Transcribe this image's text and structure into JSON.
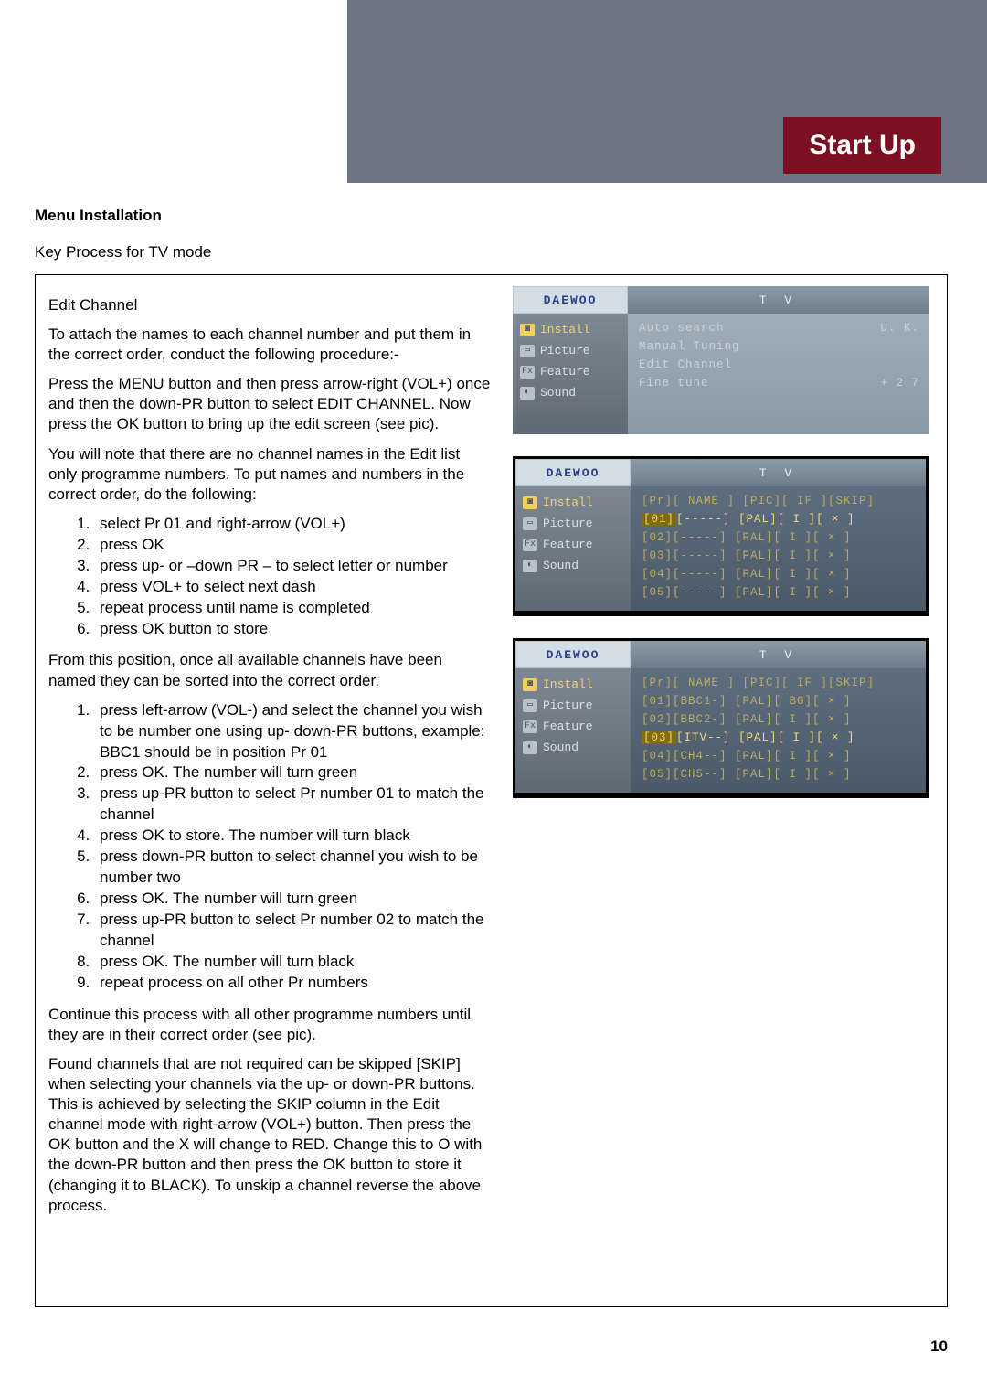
{
  "banner": {
    "title": "Start Up"
  },
  "heading": "Menu Installation",
  "subheading": "Key Process for TV mode",
  "edit_heading": "Edit Channel",
  "p1": "To attach the names to each channel number and put them in the correct order, conduct the following procedure:-",
  "p2": "Press the MENU button and then press arrow-right (VOL+) once and then the down-PR button to select EDIT CHANNEL. Now press the OK button to bring up the edit screen (see pic).",
  "p3": "You will note that there are no channel names in the Edit list only programme numbers. To put names and numbers in the correct order, do the following:",
  "listA": [
    "select Pr 01 and right-arrow (VOL+)",
    "press OK",
    "press up- or –down PR – to select letter or number",
    "press VOL+ to select next dash",
    "repeat process until name is completed",
    "press OK button to store"
  ],
  "p4": "From this position, once all available channels have been named they can be sorted into the correct order.",
  "listB": [
    "press left-arrow (VOL-) and select the channel you wish to be number one using up- down-PR buttons, example: BBC1 should be in position Pr 01",
    "press OK. The number will turn green",
    "press up-PR button to select Pr number 01 to match the channel",
    "press OK to store. The number will turn black",
    "press down-PR button to select channel you wish to be number two",
    "press OK. The number will turn green",
    "press up-PR button to select Pr number 02 to match the channel",
    "press OK. The number will turn black",
    "repeat process on all other Pr numbers"
  ],
  "p5": "Continue this process with all other programme numbers until they are in their correct order (see pic).",
  "p6": "Found channels that are not required can be skipped [SKIP] when selecting your channels via the up- or down-PR buttons. This is achieved by selecting the SKIP column in the Edit channel mode with right-arrow (VOL+) button. Then press the OK button and the X will change to RED. Change this to O with the down-PR button and then press the OK button to store it (changing it to BLACK). To unskip a channel reverse the above process.",
  "osd": {
    "logo": "DAEWOO",
    "title": "T   V",
    "menu": [
      {
        "icon": "◙",
        "label": "Install"
      },
      {
        "icon": "▭",
        "label": "Picture"
      },
      {
        "icon": "Fx",
        "label": "Feature"
      },
      {
        "icon": "◐",
        "label": "Sound"
      }
    ],
    "panel1": [
      {
        "l": "Auto search",
        "r": "U. K."
      },
      {
        "l": "Manual Tuning",
        "r": ""
      },
      {
        "l": "Edit Channel",
        "r": ""
      },
      {
        "l": "Fine tune",
        "r": "+ 2 7"
      }
    ],
    "panel2_head": "[Pr][ NAME ]  [PIC][ IF ][SKIP]",
    "panel2_rows": [
      "[01][-----]  [PAL][ I ][ × ]",
      "[02][-----]  [PAL][ I ][ × ]",
      "[03][-----]  [PAL][ I ][ × ]",
      "[04][-----]  [PAL][ I ][ × ]",
      "[05][-----]  [PAL][ I ][ × ]"
    ],
    "panel3_head": "[Pr][ NAME ]  [PIC][ IF ][SKIP]",
    "panel3_rows": [
      "[01][BBC1-]  [PAL][ BG][ × ]",
      "[02][BBC2-]  [PAL][ I ][ × ]",
      "[03][ITV--]  [PAL][ I ][ × ]",
      "[04][CH4--]  [PAL][ I ][ × ]",
      "[05][CH5--]  [PAL][ I ][ × ]"
    ]
  },
  "page": "10"
}
